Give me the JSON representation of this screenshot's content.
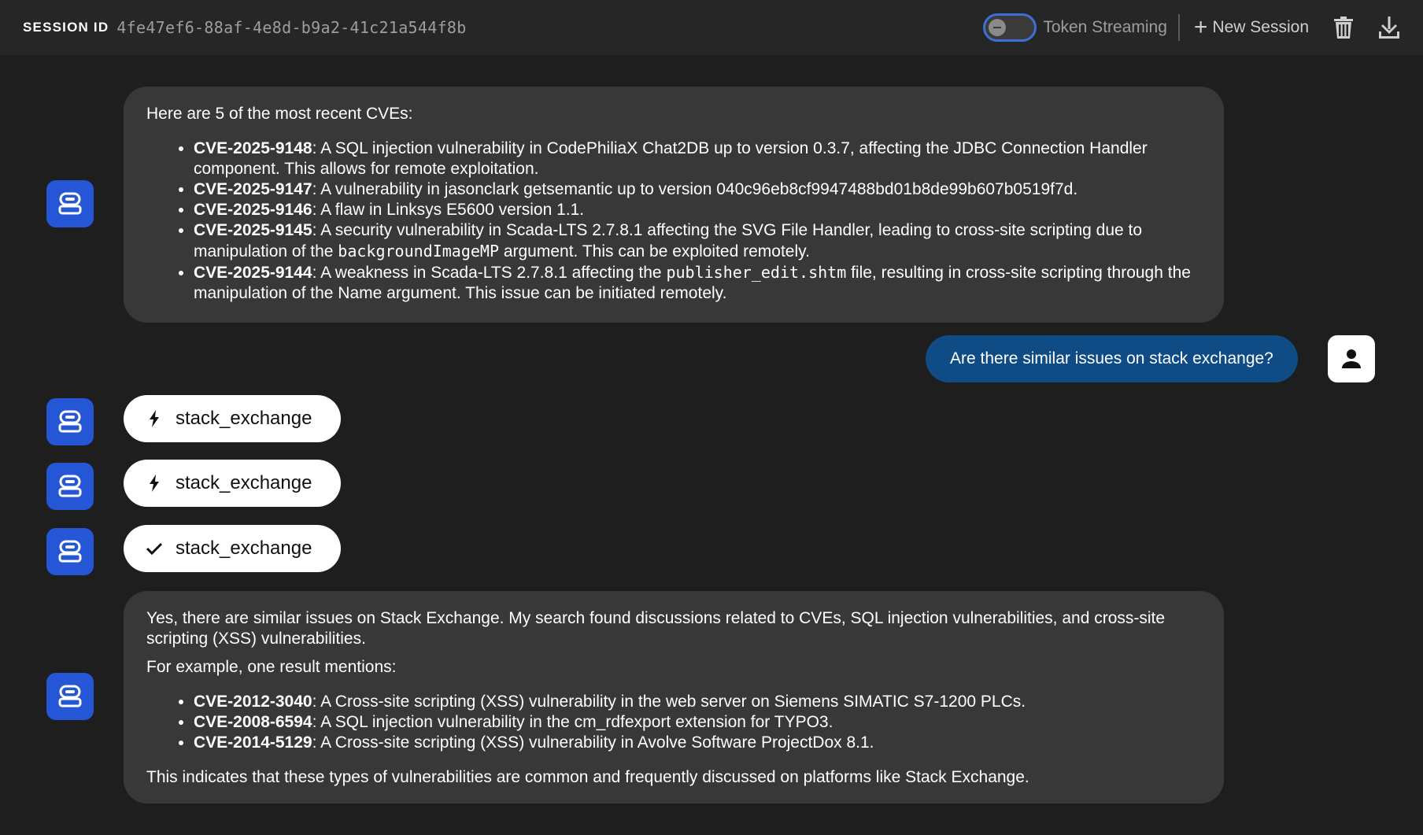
{
  "header": {
    "session_label": "SESSION ID",
    "session_id": "4fe47ef6-88af-4e8d-b9a2-41c21a544f8b",
    "streaming_label": "Token Streaming",
    "streaming_enabled": false,
    "new_session_label": "New Session",
    "delete_icon": "trash-icon",
    "download_icon": "download-icon"
  },
  "colors": {
    "background": "#1e1e1e",
    "topbar": "#262626",
    "bot_avatar": "#2456d6",
    "bot_bubble": "#383838",
    "user_bubble": "#0f4c86",
    "toggle_border": "#3d6fd6"
  },
  "messages": {
    "first": {
      "intro": "Here are 5 of the most recent CVEs:",
      "items": [
        {
          "id": "CVE-2025-9148",
          "text": ": A SQL injection vulnerability in CodePhiliaX Chat2DB up to version 0.3.7, affecting the JDBC Connection Handler component. This allows for remote exploitation."
        },
        {
          "id": "CVE-2025-9147",
          "text": ": A vulnerability in jasonclark getsemantic up to version 040c96eb8cf9947488bd01b8de99b607b0519f7d."
        },
        {
          "id": "CVE-2025-9146",
          "text": ": A flaw in Linksys E5600 version 1.1."
        },
        {
          "id": "CVE-2025-9145",
          "pre": ": A security vulnerability in Scada-LTS 2.7.8.1 affecting the SVG File Handler, leading to cross-site scripting due to manipulation of the ",
          "code": "backgroundImageMP",
          "post": " argument. This can be exploited remotely."
        },
        {
          "id": "CVE-2025-9144",
          "pre": ": A weakness in Scada-LTS 2.7.8.1 affecting the ",
          "code": "publisher_edit.shtm",
          "mid": " file, resulting in cross-site scripting through the manipulation of the ",
          "name": "Name",
          "post": " argument. This issue can be initiated remotely."
        }
      ]
    },
    "user": {
      "text": "Are there similar issues on stack exchange?"
    },
    "tools": [
      {
        "name": "stack_exchange",
        "icon": "bolt-icon"
      },
      {
        "name": "stack_exchange",
        "icon": "bolt-icon"
      },
      {
        "name": "stack_exchange",
        "icon": "check-icon"
      }
    ],
    "second": {
      "p1": "Yes, there are similar issues on Stack Exchange. My search found discussions related to CVEs, SQL injection vulnerabilities, and cross-site scripting (XSS) vulnerabilities.",
      "p2": "For example, one result mentions:",
      "items": [
        {
          "id": "CVE-2012-3040",
          "text": ": A Cross-site scripting (XSS) vulnerability in the web server on Siemens SIMATIC S7-1200 PLCs."
        },
        {
          "id": "CVE-2008-6594",
          "text": ": A SQL injection vulnerability in the cm_rdfexport extension for TYPO3."
        },
        {
          "id": "CVE-2014-5129",
          "text": ": A Cross-site scripting (XSS) vulnerability in Avolve Software ProjectDox 8.1."
        }
      ],
      "conclusion": "This indicates that these types of vulnerabilities are common and frequently discussed on platforms like Stack Exchange."
    }
  }
}
